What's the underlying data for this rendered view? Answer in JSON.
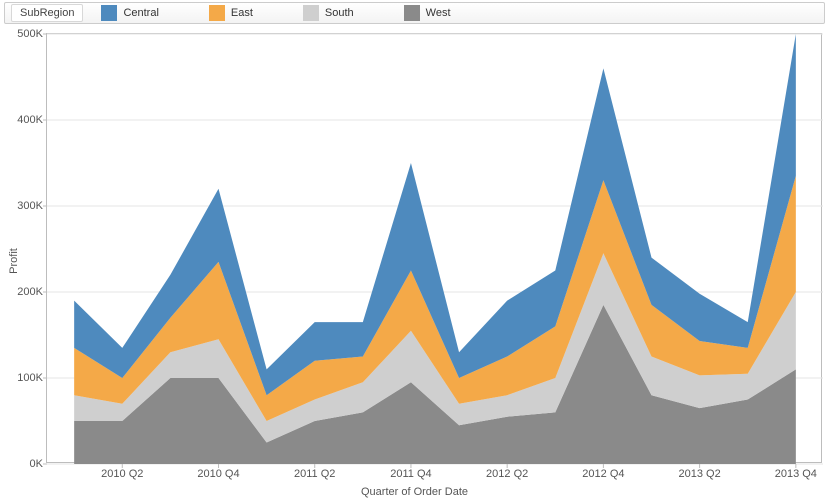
{
  "legend": {
    "title": "SubRegion",
    "items": [
      {
        "label": "Central",
        "color": "#4e8abe"
      },
      {
        "label": "East",
        "color": "#f4a948"
      },
      {
        "label": "South",
        "color": "#cfcfcf"
      },
      {
        "label": "West",
        "color": "#8a8a8a"
      }
    ]
  },
  "axes": {
    "y_title": "Profit",
    "x_title": "Quarter of Order Date"
  },
  "chart_data": {
    "type": "area",
    "xlabel": "Quarter of Order Date",
    "ylabel": "Profit",
    "ylim": [
      0,
      500000
    ],
    "y_ticks": [
      0,
      100000,
      200000,
      300000,
      400000,
      500000
    ],
    "y_tick_labels": [
      "0K",
      "100K",
      "200K",
      "300K",
      "400K",
      "500K"
    ],
    "categories": [
      "2010 Q1",
      "2010 Q2",
      "2010 Q3",
      "2010 Q4",
      "2011 Q1",
      "2011 Q2",
      "2011 Q3",
      "2011 Q4",
      "2012 Q1",
      "2012 Q2",
      "2012 Q3",
      "2012 Q4",
      "2013 Q1",
      "2013 Q2",
      "2013 Q3",
      "2013 Q4"
    ],
    "x_tick_labels": [
      "2010 Q2",
      "2010 Q4",
      "2011 Q2",
      "2011 Q4",
      "2012 Q2",
      "2012 Q4",
      "2013 Q2",
      "2013 Q4"
    ],
    "x_tick_indices": [
      1,
      3,
      5,
      7,
      9,
      11,
      13,
      15
    ],
    "series": [
      {
        "name": "West",
        "color": "#8a8a8a",
        "values": [
          50000,
          50000,
          100000,
          100000,
          25000,
          50000,
          60000,
          95000,
          45000,
          55000,
          60000,
          185000,
          80000,
          65000,
          75000,
          110000
        ]
      },
      {
        "name": "South",
        "color": "#cfcfcf",
        "values": [
          30000,
          20000,
          30000,
          45000,
          25000,
          25000,
          35000,
          60000,
          25000,
          25000,
          40000,
          60000,
          45000,
          38000,
          30000,
          90000
        ]
      },
      {
        "name": "East",
        "color": "#f4a948",
        "values": [
          55000,
          30000,
          40000,
          90000,
          30000,
          45000,
          30000,
          70000,
          30000,
          45000,
          60000,
          85000,
          60000,
          40000,
          30000,
          135000
        ]
      },
      {
        "name": "Central",
        "color": "#4e8abe",
        "values": [
          55000,
          35000,
          50000,
          85000,
          30000,
          45000,
          40000,
          125000,
          30000,
          65000,
          65000,
          130000,
          55000,
          55000,
          30000,
          165000
        ]
      }
    ],
    "legend_position": "top",
    "grid": true
  }
}
